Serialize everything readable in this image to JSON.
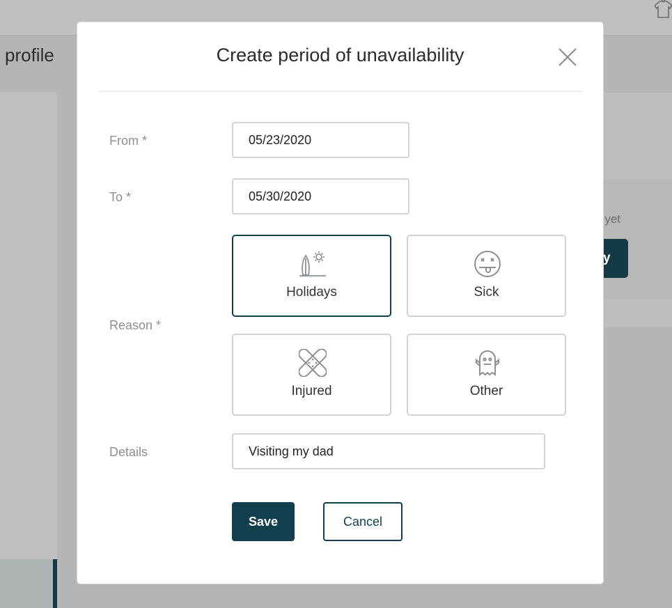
{
  "background": {
    "page_title": "profile",
    "right_text": "yet",
    "right_button": "y",
    "top_icon": "tshirt-icon"
  },
  "modal": {
    "title": "Create period of unavailability",
    "close_icon": "close-icon",
    "from": {
      "label": "From *",
      "value": "05/23/2020"
    },
    "to": {
      "label": "To *",
      "value": "05/30/2020"
    },
    "reason": {
      "label": "Reason *",
      "selected": "Holidays",
      "options": [
        {
          "label": "Holidays",
          "icon": "surfboard-sun-icon"
        },
        {
          "label": "Sick",
          "icon": "sick-face-icon"
        },
        {
          "label": "Injured",
          "icon": "bandage-icon"
        },
        {
          "label": "Other",
          "icon": "ghost-icon"
        }
      ]
    },
    "details": {
      "label": "Details",
      "value": "Visiting my dad"
    },
    "save_label": "Save",
    "cancel_label": "Cancel"
  },
  "colors": {
    "accent": "#123f4d",
    "overlay": "#b5b5b5"
  }
}
